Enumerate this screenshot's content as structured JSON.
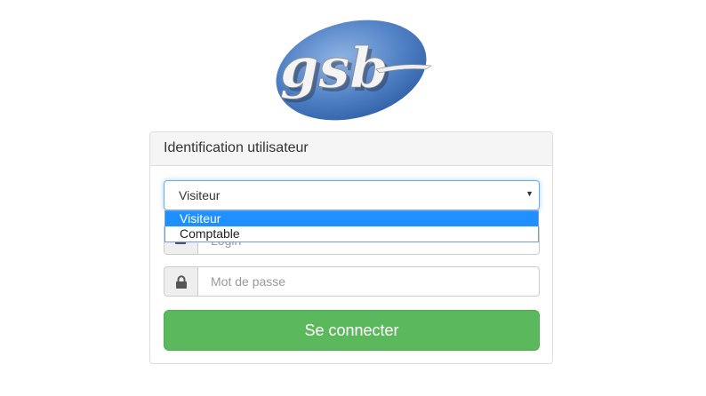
{
  "logo": {
    "text": "gsb",
    "color": "#4a7ec2"
  },
  "panel": {
    "title": "Identification utilisateur"
  },
  "role_select": {
    "selected": "Visiteur",
    "options": [
      "Visiteur",
      "Comptable"
    ],
    "highlighted_option": "Visiteur"
  },
  "login_field": {
    "placeholder": "Login"
  },
  "password_field": {
    "placeholder": "Mot de passe"
  },
  "submit": {
    "label": "Se connecter",
    "color": "#5cb85c"
  },
  "colors": {
    "focus_border": "#66afe9",
    "option_highlight": "#1e90ff",
    "panel_heading_bg": "#f5f5f5"
  }
}
